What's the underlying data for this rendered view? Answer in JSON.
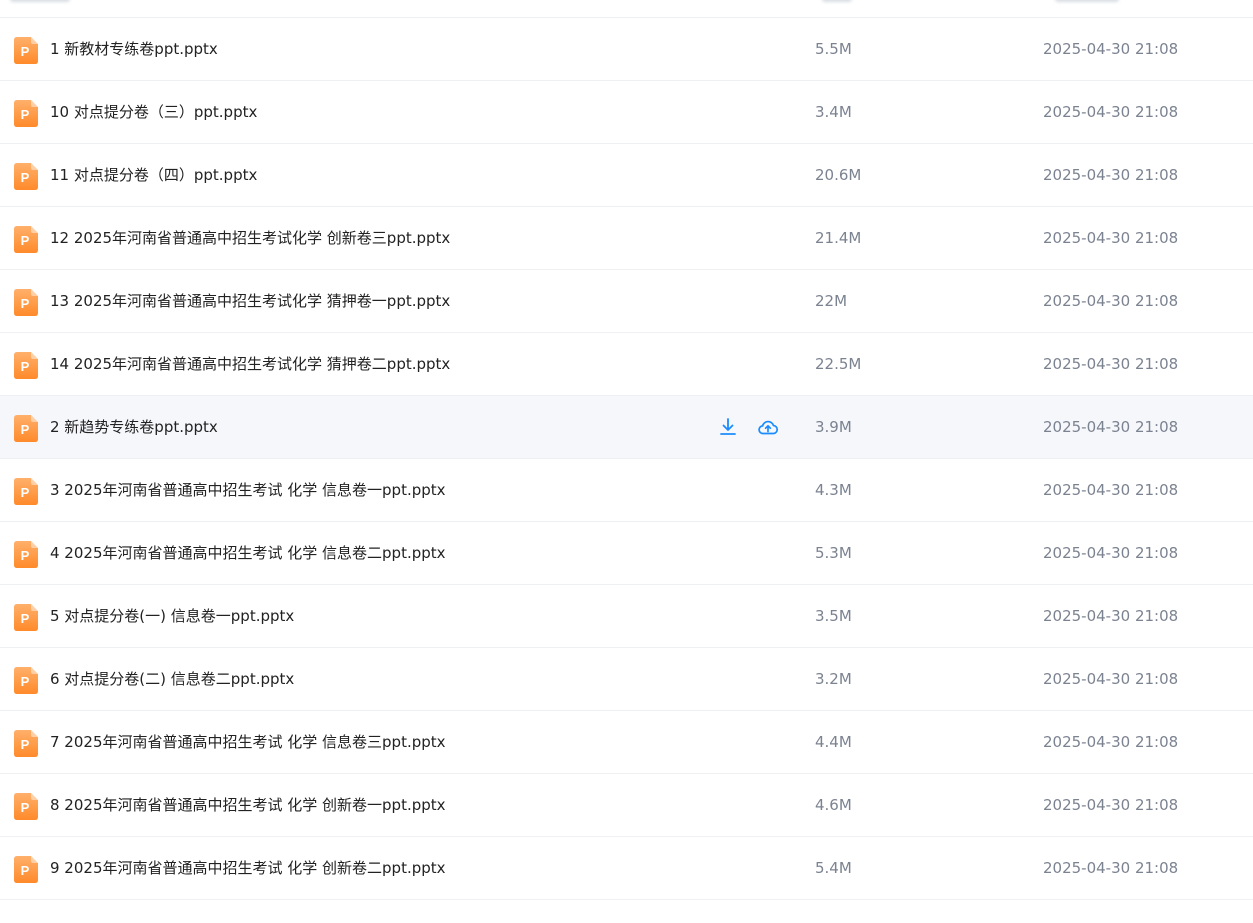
{
  "colors": {
    "accent": "#1a8cff",
    "ppt_icon_top": "#ffb06b",
    "ppt_icon_bottom": "#ff8a2a",
    "text_primary": "#222222",
    "text_secondary": "#7b8290",
    "row_hover_bg": "#f5f7fb"
  },
  "row_actions": {
    "download_icon": "download-icon",
    "save_to_cloud_icon": "cloud-upload-icon"
  },
  "files": [
    {
      "name": "1 新教材专练卷ppt.pptx",
      "size": "5.5M",
      "date": "2025-04-30 21:08",
      "icon": "ppt-file-icon",
      "icon_letter": "P"
    },
    {
      "name": "10 对点提分卷（三）ppt.pptx",
      "size": "3.4M",
      "date": "2025-04-30 21:08",
      "icon": "ppt-file-icon",
      "icon_letter": "P"
    },
    {
      "name": "11 对点提分卷（四）ppt.pptx",
      "size": "20.6M",
      "date": "2025-04-30 21:08",
      "icon": "ppt-file-icon",
      "icon_letter": "P"
    },
    {
      "name": "12 2025年河南省普通高中招生考试化学 创新卷三ppt.pptx",
      "size": "21.4M",
      "date": "2025-04-30 21:08",
      "icon": "ppt-file-icon",
      "icon_letter": "P"
    },
    {
      "name": "13 2025年河南省普通高中招生考试化学 猜押卷一ppt.pptx",
      "size": "22M",
      "date": "2025-04-30 21:08",
      "icon": "ppt-file-icon",
      "icon_letter": "P"
    },
    {
      "name": "14 2025年河南省普通高中招生考试化学 猜押卷二ppt.pptx",
      "size": "22.5M",
      "date": "2025-04-30 21:08",
      "icon": "ppt-file-icon",
      "icon_letter": "P"
    },
    {
      "name": "2 新趋势专练卷ppt.pptx",
      "size": "3.9M",
      "date": "2025-04-30 21:08",
      "icon": "ppt-file-icon",
      "icon_letter": "P",
      "hovered": true
    },
    {
      "name": "3 2025年河南省普通高中招生考试 化学 信息卷一ppt.pptx",
      "size": "4.3M",
      "date": "2025-04-30 21:08",
      "icon": "ppt-file-icon",
      "icon_letter": "P"
    },
    {
      "name": "4 2025年河南省普通高中招生考试 化学 信息卷二ppt.pptx",
      "size": "5.3M",
      "date": "2025-04-30 21:08",
      "icon": "ppt-file-icon",
      "icon_letter": "P"
    },
    {
      "name": "5 对点提分卷(一) 信息卷一ppt.pptx",
      "size": "3.5M",
      "date": "2025-04-30 21:08",
      "icon": "ppt-file-icon",
      "icon_letter": "P"
    },
    {
      "name": "6 对点提分卷(二) 信息卷二ppt.pptx",
      "size": "3.2M",
      "date": "2025-04-30 21:08",
      "icon": "ppt-file-icon",
      "icon_letter": "P"
    },
    {
      "name": "7 2025年河南省普通高中招生考试 化学 信息卷三ppt.pptx",
      "size": "4.4M",
      "date": "2025-04-30 21:08",
      "icon": "ppt-file-icon",
      "icon_letter": "P"
    },
    {
      "name": "8 2025年河南省普通高中招生考试 化学 创新卷一ppt.pptx",
      "size": "4.6M",
      "date": "2025-04-30 21:08",
      "icon": "ppt-file-icon",
      "icon_letter": "P"
    },
    {
      "name": "9 2025年河南省普通高中招生考试 化学 创新卷二ppt.pptx",
      "size": "5.4M",
      "date": "2025-04-30 21:08",
      "icon": "ppt-file-icon",
      "icon_letter": "P"
    }
  ]
}
